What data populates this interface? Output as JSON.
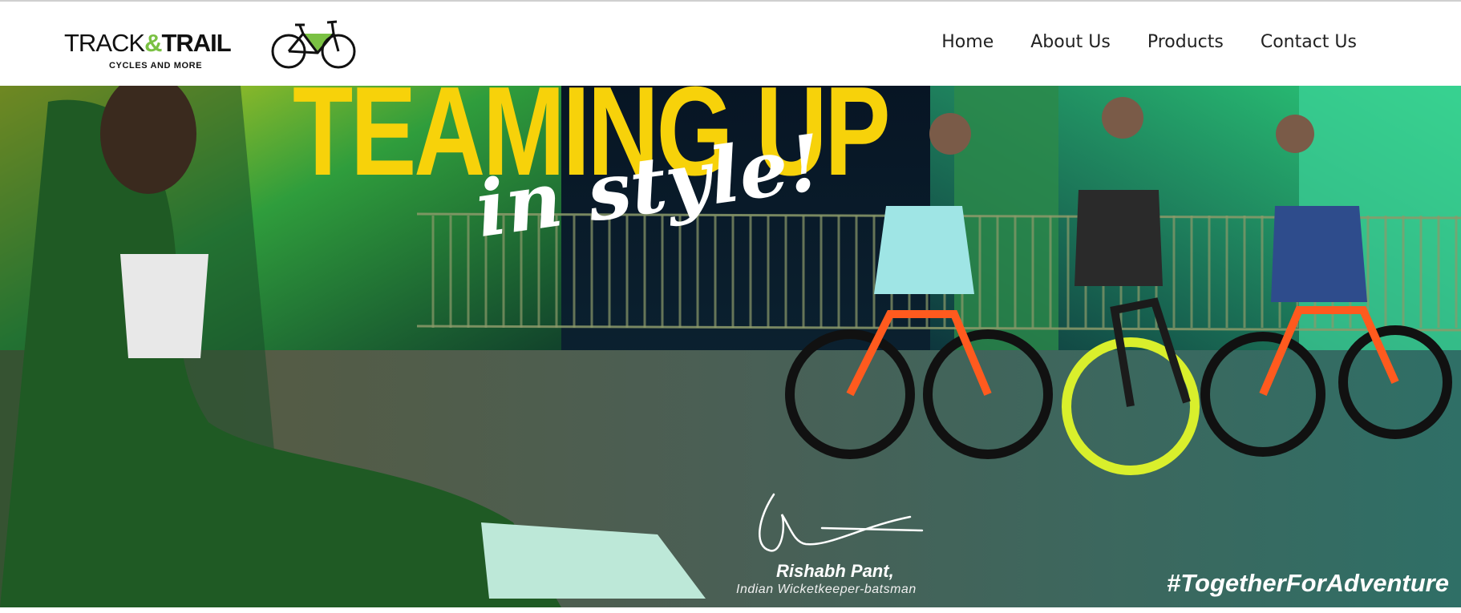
{
  "brand": {
    "word1": "TRACK",
    "ampersand": "&",
    "word2": "TRAIL",
    "tagline": "CYCLES AND MORE",
    "accent_color": "#7ac143",
    "icon": "bicycle-icon"
  },
  "nav": {
    "items": [
      {
        "label": "Home"
      },
      {
        "label": "About Us"
      },
      {
        "label": "Products"
      },
      {
        "label": "Contact Us"
      }
    ]
  },
  "hero": {
    "headline": "TEAMING UP",
    "subhead": "in style!",
    "headline_color": "#f7d20a",
    "signer_name": "Rishabh Pant,",
    "signer_role": "Indian Wicketkeeper-batsman",
    "hashtag": "#TogetherForAdventure"
  }
}
